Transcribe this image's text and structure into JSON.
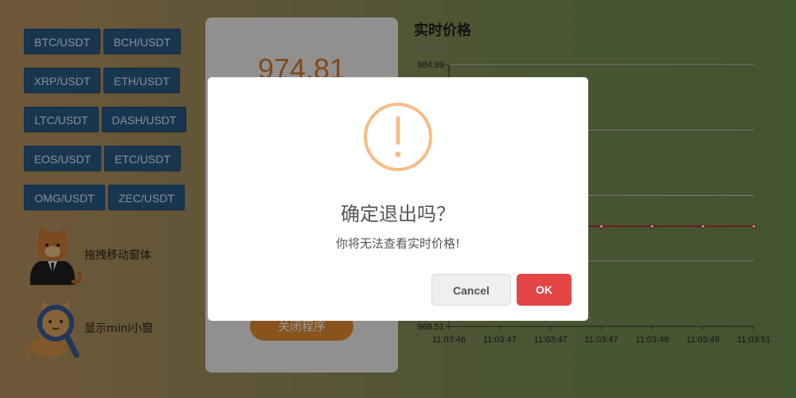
{
  "pairs": [
    {
      "label": "BTC/USDT"
    },
    {
      "label": "BCH/USDT"
    },
    {
      "label": "XRP/USDT"
    },
    {
      "label": "ETH/USDT"
    },
    {
      "label": "LTC/USDT"
    },
    {
      "label": "DASH/USDT"
    },
    {
      "label": "EOS/USDT"
    },
    {
      "label": "ETC/USDT"
    },
    {
      "label": "OMG/USDT"
    },
    {
      "label": "ZEC/USDT"
    }
  ],
  "tools": {
    "drag": {
      "label": "拖拽移动窗体",
      "icon": "cat-in-suit-icon"
    },
    "mini": {
      "label": "显示mini小窗",
      "icon": "cat-magnifier-icon"
    }
  },
  "price_card": {
    "price": "974.81",
    "close_label": "关闭程序"
  },
  "chart_header": {
    "title": "实时价格",
    "subtitle": "Moumou"
  },
  "chart_data": {
    "type": "line",
    "title": "实时价格",
    "subtitle": "Moumou",
    "x": [
      "11:03:46",
      "11:03:47",
      "11:03:47",
      "11:03:47",
      "11:03:48",
      "11:03:49",
      "11:03:51"
    ],
    "series": [
      {
        "values": [
          974.81,
          974.81,
          974.81,
          974.81,
          974.81,
          974.81,
          974.81
        ],
        "color": "#b03030"
      }
    ],
    "ylim": [
      968.51,
      984.99
    ],
    "ytick_labels": [
      "984.99",
      "968.51"
    ],
    "grid": true
  },
  "dialog": {
    "icon": "warning-icon",
    "title": "确定退出吗？",
    "text": "你将无法查看实时价格!",
    "cancel_label": "Cancel",
    "ok_label": "OK",
    "colors": {
      "warning": "#f8bb86",
      "ok": "#e34545",
      "cancel": "#efefef"
    }
  }
}
